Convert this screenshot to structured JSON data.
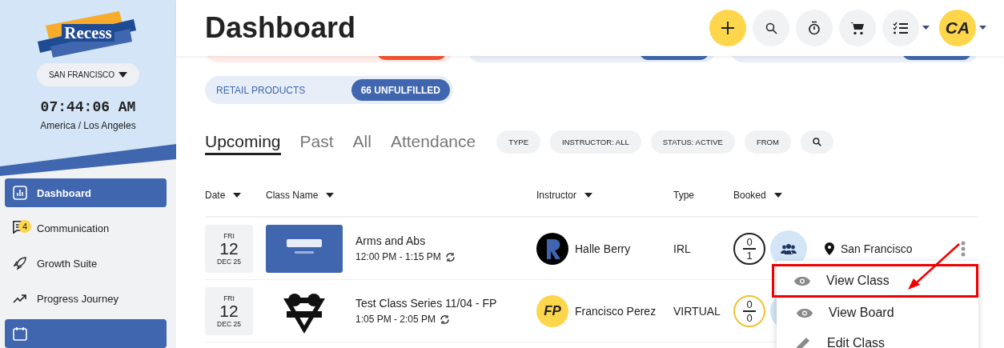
{
  "sidebar": {
    "logo": "Recess",
    "location": "SAN FRANCISCO",
    "time": "07:44:06 AM",
    "timezone": "America / Los Angeles",
    "items": [
      {
        "kind": "dashboard",
        "label": "Dashboard",
        "selected": true
      },
      {
        "kind": "communication",
        "label": "Communication",
        "badge": "4",
        "selected": false
      },
      {
        "kind": "growth",
        "label": "Growth Suite",
        "selected": false
      },
      {
        "kind": "progress",
        "label": "Progress Journey",
        "selected": false
      },
      {
        "kind": "schedule",
        "selected": true
      }
    ]
  },
  "header": {
    "title": "Dashboard",
    "avatar": "CA"
  },
  "summary_cards": [
    {
      "kind": "alert"
    },
    {
      "kind": "info"
    },
    {
      "kind": "info"
    }
  ],
  "retail": {
    "label": "RETAIL PRODUCTS",
    "badge": "66 UNFULFILLED"
  },
  "tabs": [
    {
      "label": "Upcoming",
      "selected": true
    },
    {
      "label": "Past",
      "selected": false
    },
    {
      "label": "All",
      "selected": false
    },
    {
      "label": "Attendance",
      "selected": false
    }
  ],
  "filters": [
    {
      "kind": "text",
      "label": "TYPE"
    },
    {
      "kind": "text",
      "label": "INSTRUCTOR: ALL"
    },
    {
      "kind": "text",
      "label": "STATUS: ACTIVE"
    },
    {
      "kind": "text",
      "label": "FROM"
    },
    {
      "kind": "search"
    }
  ],
  "table": {
    "columns": [
      {
        "label": "Date",
        "sortable": true
      },
      {
        "label": "Class Name",
        "sortable": true
      },
      {
        "label": "Instructor",
        "sortable": true
      },
      {
        "label": "Type",
        "sortable": false
      },
      {
        "label": "Booked",
        "sortable": true
      }
    ],
    "rows": [
      {
        "day": "FRI",
        "date": "12",
        "month": "DEC 25",
        "name": "Arms and Abs",
        "time": "12:00 PM - 1:15 PM",
        "instructor": "Halle Berry",
        "type": "IRL",
        "booked": "0",
        "capacity": "1",
        "color": "#222222",
        "location": "San Francisco"
      },
      {
        "day": "FRI",
        "date": "12",
        "month": "DEC 25",
        "name": "Test Class Series 11/04 - FP",
        "time": "1:05 PM - 2:05 PM",
        "instructor": "Francisco Perez",
        "initials": "FP",
        "type": "VIRTUAL",
        "booked": "0",
        "capacity": "0",
        "color": "#f2c230"
      }
    ]
  },
  "row_menu": {
    "items": [
      {
        "kind": "view",
        "label": "View Class",
        "highlighted": true
      },
      {
        "kind": "view",
        "label": "View Board",
        "highlighted": false
      },
      {
        "kind": "edit",
        "label": "Edit Class",
        "highlighted": false
      }
    ]
  }
}
